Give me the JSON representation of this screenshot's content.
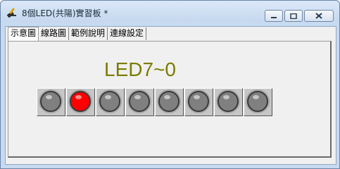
{
  "window": {
    "title": "8個LED(共陽)實習板 *",
    "minimize_icon": "minimize-icon",
    "maximize_icon": "maximize-icon",
    "close_icon": "close-icon",
    "app_icon": "app-tool-icon"
  },
  "tabs": [
    {
      "label": "示意圖",
      "active": true
    },
    {
      "label": "線路圖",
      "active": false
    },
    {
      "label": "範例說明",
      "active": false
    },
    {
      "label": "連線設定",
      "active": false
    }
  ],
  "diagram": {
    "heading": "LED7~0",
    "heading_color": "#7b7b00",
    "led_on_color": "#ff0000",
    "led_off_color": "#808080",
    "leds": [
      {
        "on": false
      },
      {
        "on": true
      },
      {
        "on": false
      },
      {
        "on": false
      },
      {
        "on": false
      },
      {
        "on": false
      },
      {
        "on": false
      },
      {
        "on": false
      }
    ]
  }
}
